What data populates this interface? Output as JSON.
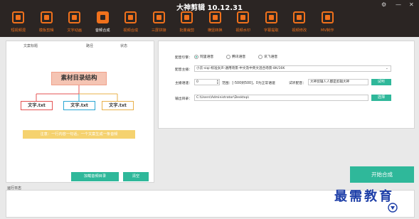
{
  "window": {
    "title": "大神剪辑 10.12.31",
    "controls": {
      "settings": "⚙",
      "minimize": "—",
      "close": "✕"
    }
  },
  "nav": [
    {
      "label": "短视频混",
      "icon": "video-mix-icon",
      "active": false
    },
    {
      "label": "模板剪辑",
      "icon": "template-icon",
      "active": false
    },
    {
      "label": "文字动画",
      "icon": "text-animation-icon",
      "active": false
    },
    {
      "label": "音频合成",
      "icon": "audio-compose-icon",
      "active": true
    },
    {
      "label": "视频合成",
      "icon": "video-compose-icon",
      "active": false
    },
    {
      "label": "三屏拼接",
      "icon": "three-screen-icon",
      "active": false
    },
    {
      "label": "批量裁剪",
      "icon": "crop-icon",
      "active": false
    },
    {
      "label": "横竖转换",
      "icon": "rotate-icon",
      "active": false
    },
    {
      "label": "视频水印",
      "icon": "watermark-icon",
      "active": false
    },
    {
      "label": "字幕提取",
      "icon": "subtitle-icon",
      "active": false
    },
    {
      "label": "视频修改",
      "icon": "video-edit-icon",
      "active": false
    },
    {
      "label": "MV制作",
      "icon": "mv-icon",
      "active": false
    }
  ],
  "table": {
    "col_title": "文案标题",
    "col_duration": "路径",
    "col_status": "状态"
  },
  "diagram": {
    "title": "素材目录结构",
    "box1": "文字.txt",
    "box2": "文字.txt",
    "box3": "文字.txt",
    "banner": "注意：一行内容一句话，一个文案生成一条音频"
  },
  "left_buttons": {
    "load": "加载音频目录",
    "clear": "清空"
  },
  "settings": {
    "engine_label": "配音引擎：",
    "engine_options": [
      "阿里语音",
      "腾讯语音",
      "讯飞语音"
    ],
    "engine_selected": 0,
    "voice_label": "配音主播：",
    "voice_value": "小云-siqi-标准女声-通用场景-中文及中英文混合场景-8K/16K",
    "volume_label": "主播语速：",
    "volume_value": "0",
    "range_text": "范围：[-500到500]，0为正常语速",
    "test_label": "试听配音：",
    "test_value": "大神剪辑人人都是剪辑大神",
    "test_button": "试听",
    "output_label": "输出目录：",
    "output_value": "C:\\Users\\Administrator\\Desktop\\",
    "output_button": "选择"
  },
  "start_button": "开始合成",
  "log_label": "运行日志",
  "watermark_text": "最需教育",
  "colors": {
    "accent": "#f0711c",
    "green": "#2fb89a",
    "topbar": "#2b2523"
  }
}
